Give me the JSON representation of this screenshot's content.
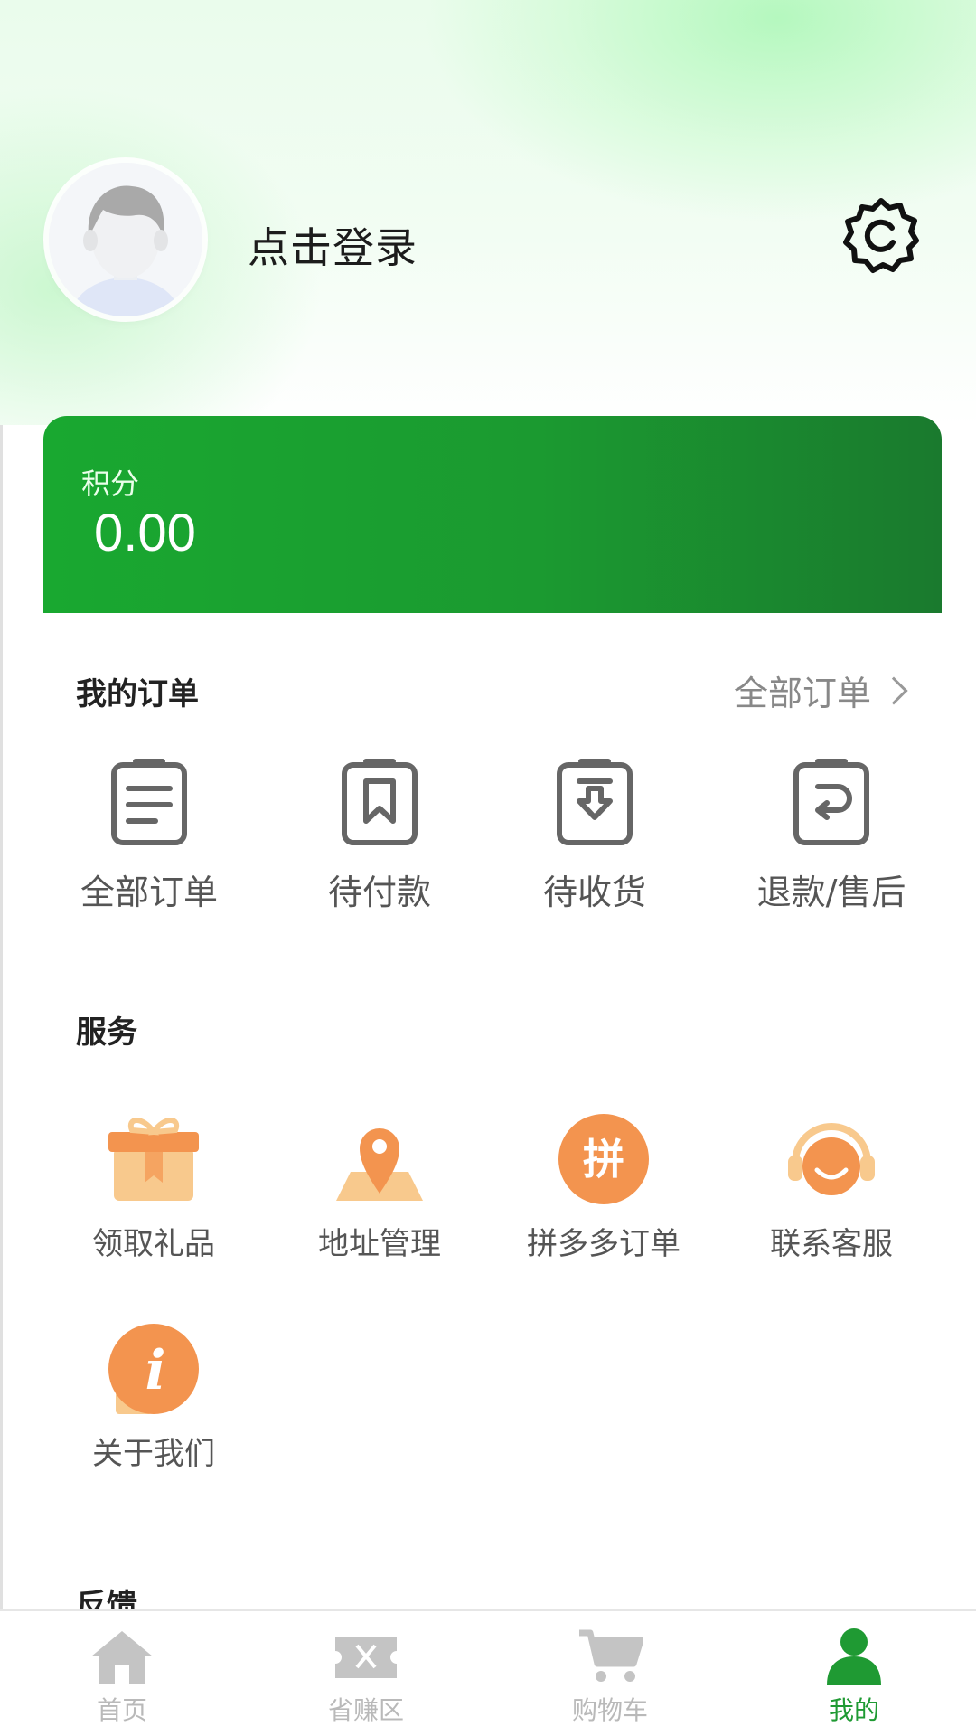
{
  "header": {
    "login_text": "点击登录"
  },
  "points": {
    "label": "积分",
    "value": "0.00"
  },
  "orders": {
    "title": "我的订单",
    "all_link": "全部订单",
    "items": [
      {
        "label": "全部订单",
        "icon": "order-list-icon"
      },
      {
        "label": "待付款",
        "icon": "bookmark-icon"
      },
      {
        "label": "待收货",
        "icon": "download-box-icon"
      },
      {
        "label": "退款/售后",
        "icon": "return-icon"
      }
    ]
  },
  "services": {
    "title": "服务",
    "items": [
      {
        "label": "领取礼品",
        "icon": "gift-icon"
      },
      {
        "label": "地址管理",
        "icon": "location-icon"
      },
      {
        "label": "拼多多订单",
        "icon": "pin-icon",
        "glyph": "拼"
      },
      {
        "label": "联系客服",
        "icon": "headset-icon"
      },
      {
        "label": "关于我们",
        "icon": "info-icon",
        "glyph": "i"
      }
    ]
  },
  "feedback": {
    "title": "反馈"
  },
  "tabbar": {
    "items": [
      {
        "label": "首页",
        "icon": "home-icon"
      },
      {
        "label": "省赚区",
        "icon": "ticket-icon"
      },
      {
        "label": "购物车",
        "icon": "cart-icon"
      },
      {
        "label": "我的",
        "icon": "user-icon",
        "active": true
      }
    ]
  },
  "colors": {
    "accent_green": "#1f9a33",
    "orange": "#f3944f",
    "light_orange": "#f8c98d",
    "gray_icon": "#666666"
  }
}
